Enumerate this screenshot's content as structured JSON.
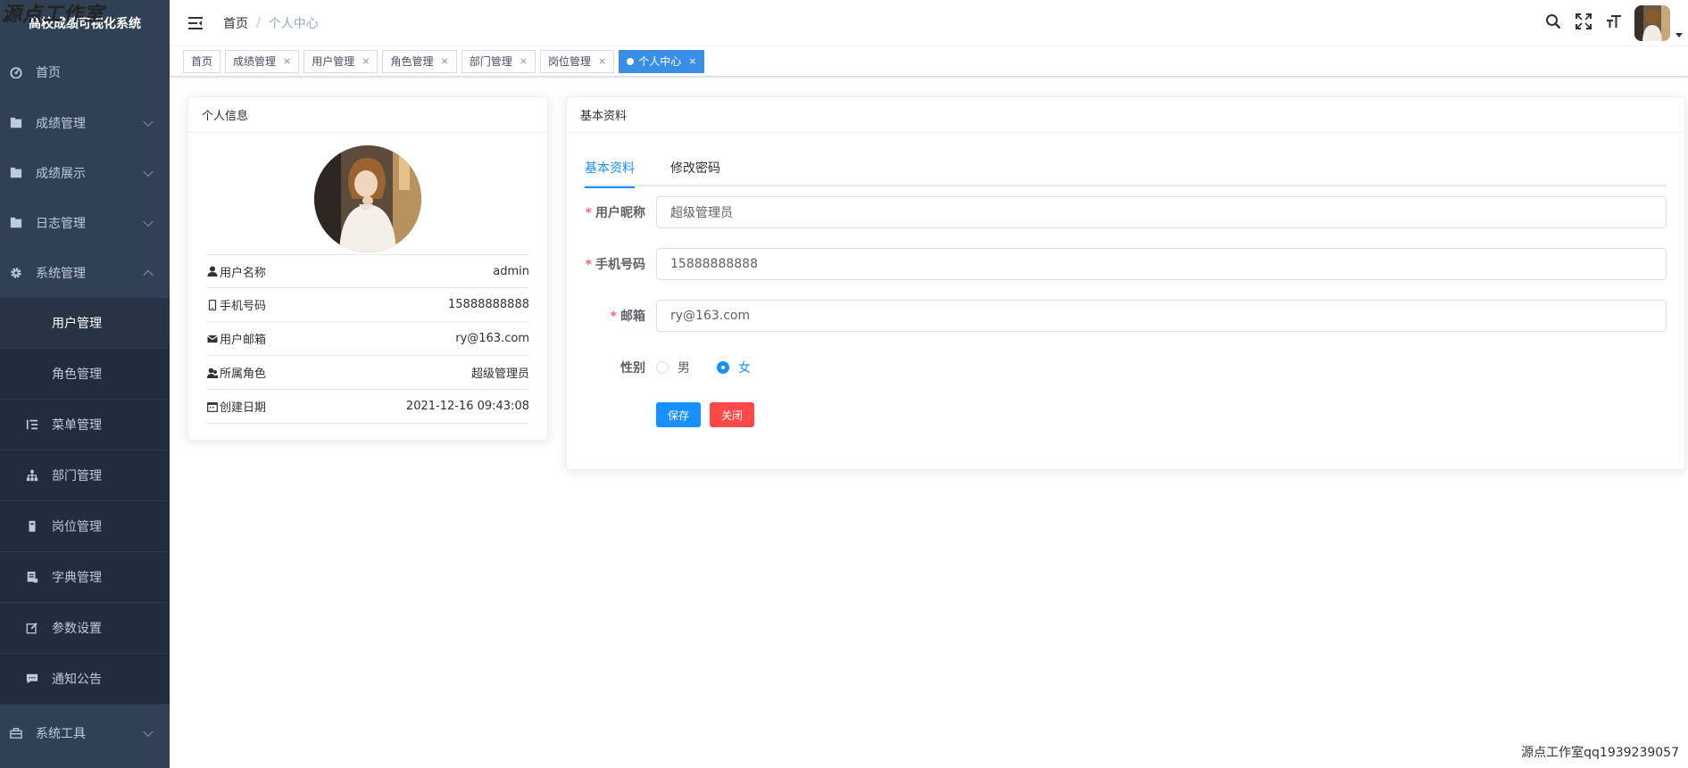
{
  "watermark_top": "源点工作室",
  "watermark_bottom": "源点工作室qq1939239057",
  "app": {
    "title": "高校成绩可视化系统"
  },
  "sidebar": {
    "items": [
      {
        "label": "首页",
        "icon": "dashboard-icon"
      },
      {
        "label": "成绩管理",
        "icon": "folder-icon"
      },
      {
        "label": "成绩展示",
        "icon": "folder-icon"
      },
      {
        "label": "日志管理",
        "icon": "folder-icon"
      },
      {
        "label": "系统管理",
        "icon": "gear-icon"
      }
    ],
    "sub_items": [
      {
        "label": "用户管理"
      },
      {
        "label": "角色管理"
      },
      {
        "label": "菜单管理",
        "icon": "tree-table-icon"
      },
      {
        "label": "部门管理",
        "icon": "tree-icon"
      },
      {
        "label": "岗位管理",
        "icon": "post-icon"
      },
      {
        "label": "字典管理",
        "icon": "dict-icon"
      },
      {
        "label": "参数设置",
        "icon": "edit-icon"
      },
      {
        "label": "通知公告",
        "icon": "message-icon"
      }
    ],
    "tools": {
      "label": "系统工具",
      "icon": "tool-icon"
    }
  },
  "navbar": {
    "breadcrumb": [
      "首页",
      "个人中心"
    ],
    "breadcrumb_sep": "/"
  },
  "tags": [
    {
      "label": "首页",
      "closable": false
    },
    {
      "label": "成绩管理",
      "closable": true
    },
    {
      "label": "用户管理",
      "closable": true
    },
    {
      "label": "角色管理",
      "closable": true
    },
    {
      "label": "部门管理",
      "closable": true
    },
    {
      "label": "岗位管理",
      "closable": true
    },
    {
      "label": "个人中心",
      "closable": true,
      "active": true
    }
  ],
  "tag_close": "×",
  "profile": {
    "title": "个人信息",
    "rows": [
      {
        "key": "用户名称",
        "value": "admin",
        "icon": "user-icon"
      },
      {
        "key": "手机号码",
        "value": "15888888888",
        "icon": "phone-icon"
      },
      {
        "key": "用户邮箱",
        "value": "ry@163.com",
        "icon": "email-icon"
      },
      {
        "key": "所属角色",
        "value": "超级管理员",
        "icon": "peoples-icon"
      },
      {
        "key": "创建日期",
        "value": "2021-12-16 09:43:08",
        "icon": "date-icon"
      }
    ]
  },
  "basic": {
    "title": "基本资料",
    "tabs": [
      "基本资料",
      "修改密码"
    ],
    "fields": {
      "nickname": {
        "label": "用户昵称",
        "value": "超级管理员"
      },
      "phone": {
        "label": "手机号码",
        "value": "15888888888"
      },
      "email": {
        "label": "邮箱",
        "value": "ry@163.com"
      },
      "gender": {
        "label": "性别",
        "options": [
          "男",
          "女"
        ],
        "selected": "女"
      }
    },
    "required_mark": "*",
    "save": "保存",
    "close": "关闭"
  },
  "colors": {
    "sidebar": "#304156",
    "submenu": "#1f2d3d",
    "primary": "#1890ff",
    "danger": "#ff4949"
  }
}
